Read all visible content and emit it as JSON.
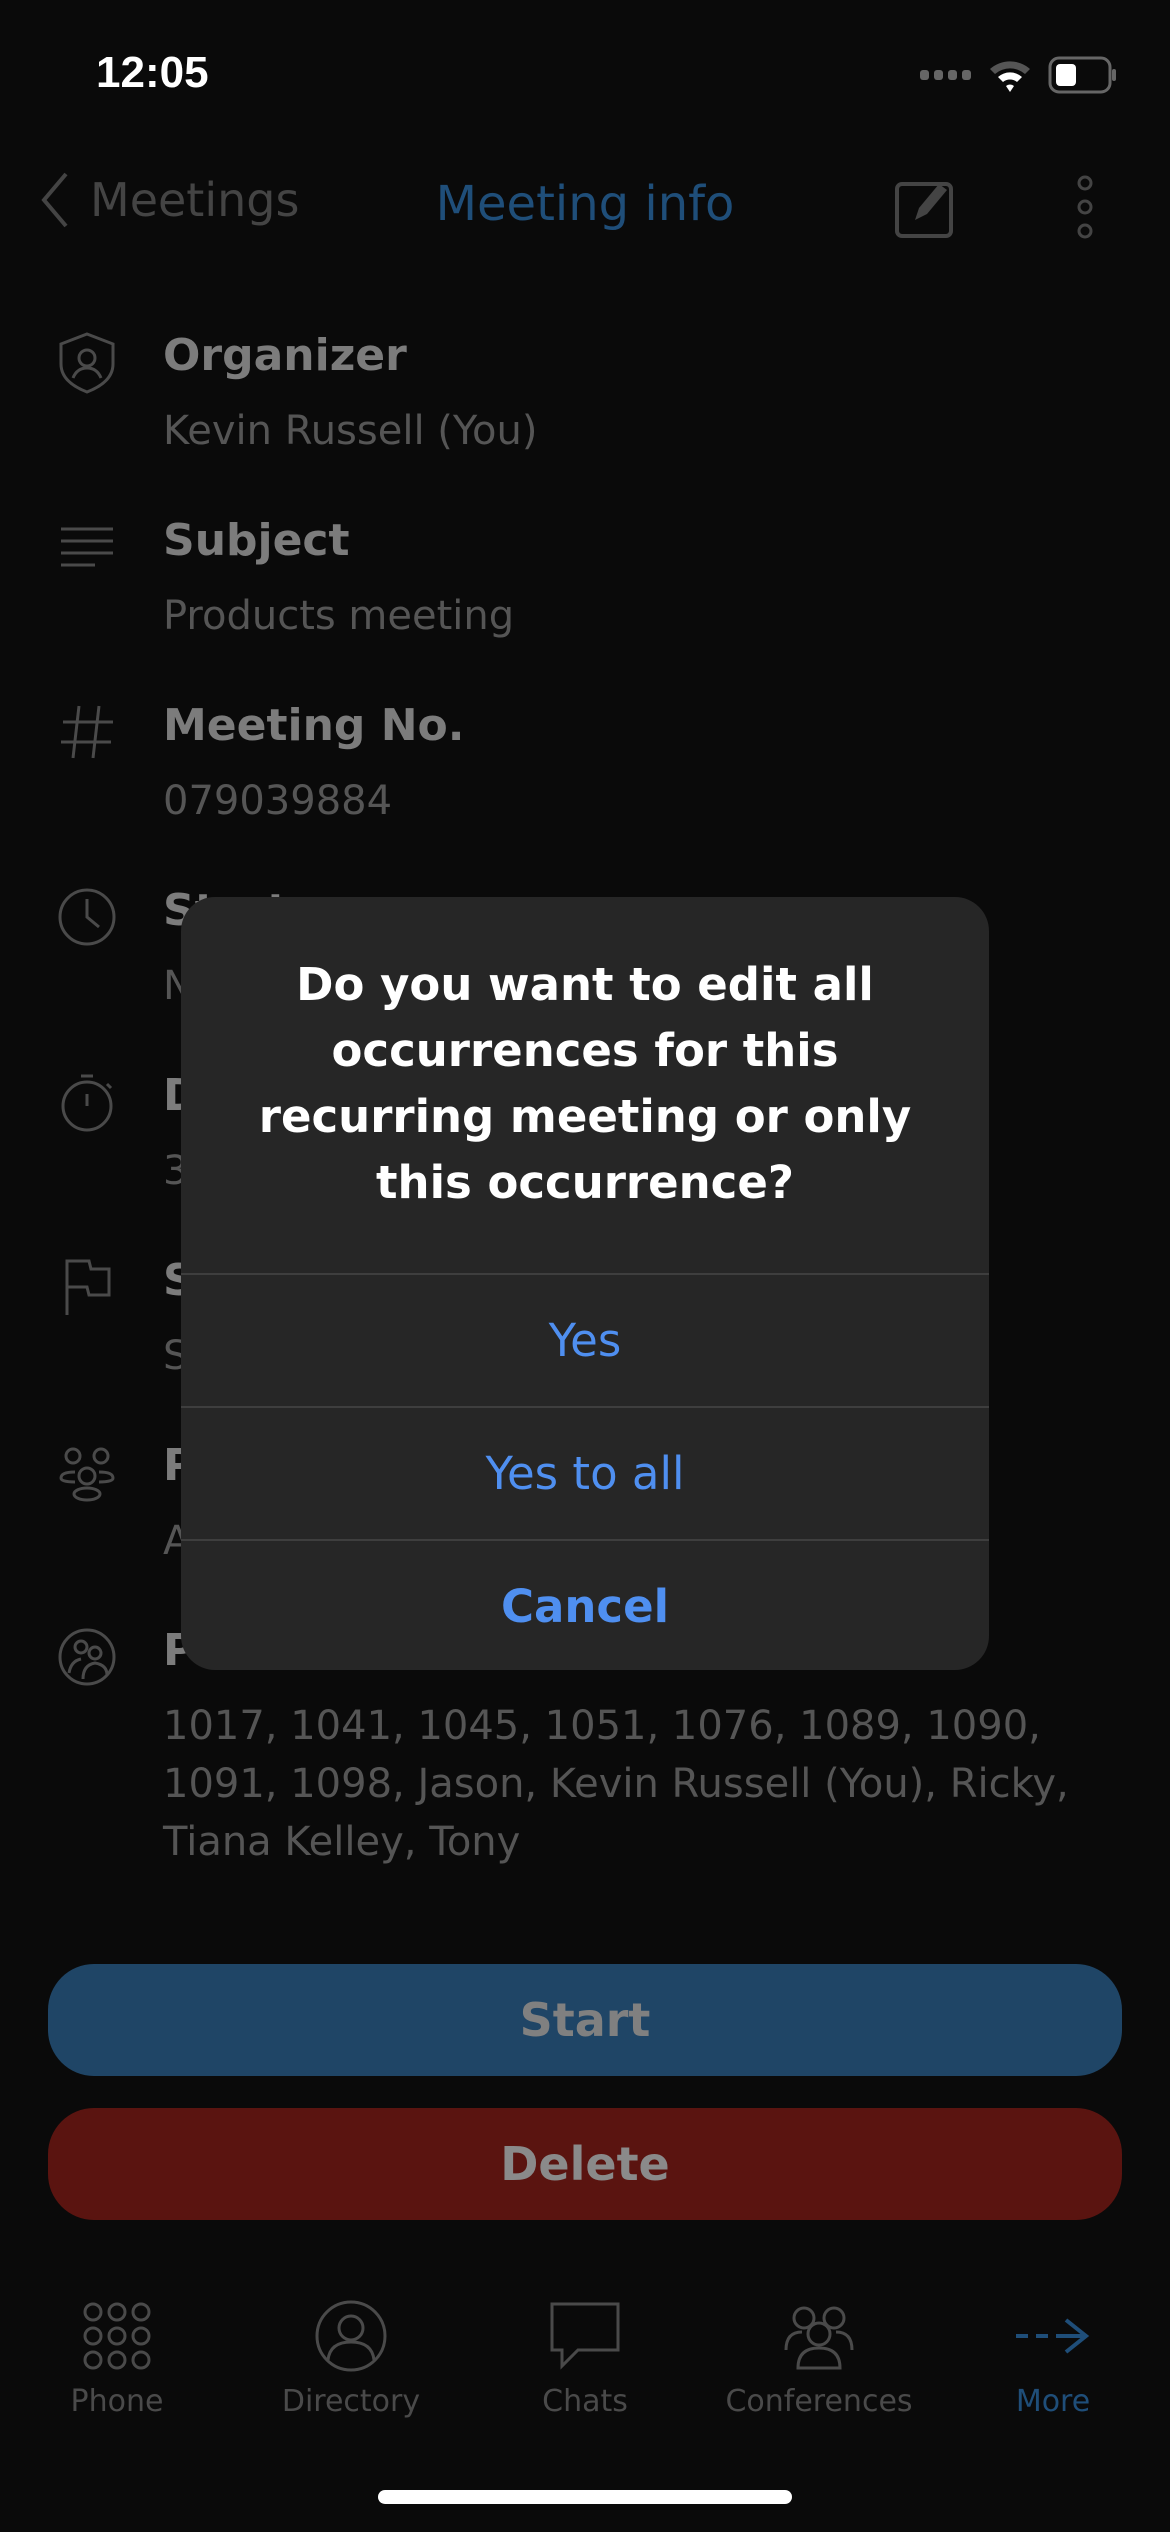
{
  "status_bar": {
    "time": "12:05"
  },
  "nav": {
    "back_label": "Meetings",
    "title": "Meeting info",
    "icons": [
      "chevron-left-icon",
      "edit-icon",
      "more-vertical-icon"
    ]
  },
  "rows": [
    {
      "label": "Organizer",
      "value": "Kevin Russell (You)",
      "icon": "shield-user-icon"
    },
    {
      "label": "Subject",
      "value": "Products meeting",
      "icon": "text-lines-icon"
    },
    {
      "label": "Meeting No.",
      "value": "079039884",
      "icon": "hash-icon"
    },
    {
      "label": "Start",
      "value": "N",
      "icon": "clock-icon"
    },
    {
      "label": "D",
      "value": "3",
      "icon": "stopwatch-icon"
    },
    {
      "label": "S",
      "value": "S",
      "icon": "flag-icon"
    },
    {
      "label": "P",
      "value": "A",
      "icon": "group-icon"
    },
    {
      "label": "P",
      "value": "1017, 1041, 1045, 1051, 1076, 1089, 1090, 1091, 1098, Jason, Kevin Russell (You), Ricky, Tiana Kelley, Tony",
      "icon": "participants-icon"
    }
  ],
  "actions": {
    "start": "Start",
    "delete": "Delete"
  },
  "dialog": {
    "message": "Do you want to edit all occurrences for this recurring meeting or only this occurrence?",
    "yes": "Yes",
    "yes_all": "Yes to all",
    "cancel": "Cancel"
  },
  "tabs": [
    {
      "label": "Phone"
    },
    {
      "label": "Directory"
    },
    {
      "label": "Chats"
    },
    {
      "label": "Conferences"
    },
    {
      "label": "More"
    }
  ],
  "colors": {
    "accent": "#1f4e79",
    "dialog_button": "#4f8ff0",
    "start": "#1f4566",
    "delete": "#5a1410"
  }
}
